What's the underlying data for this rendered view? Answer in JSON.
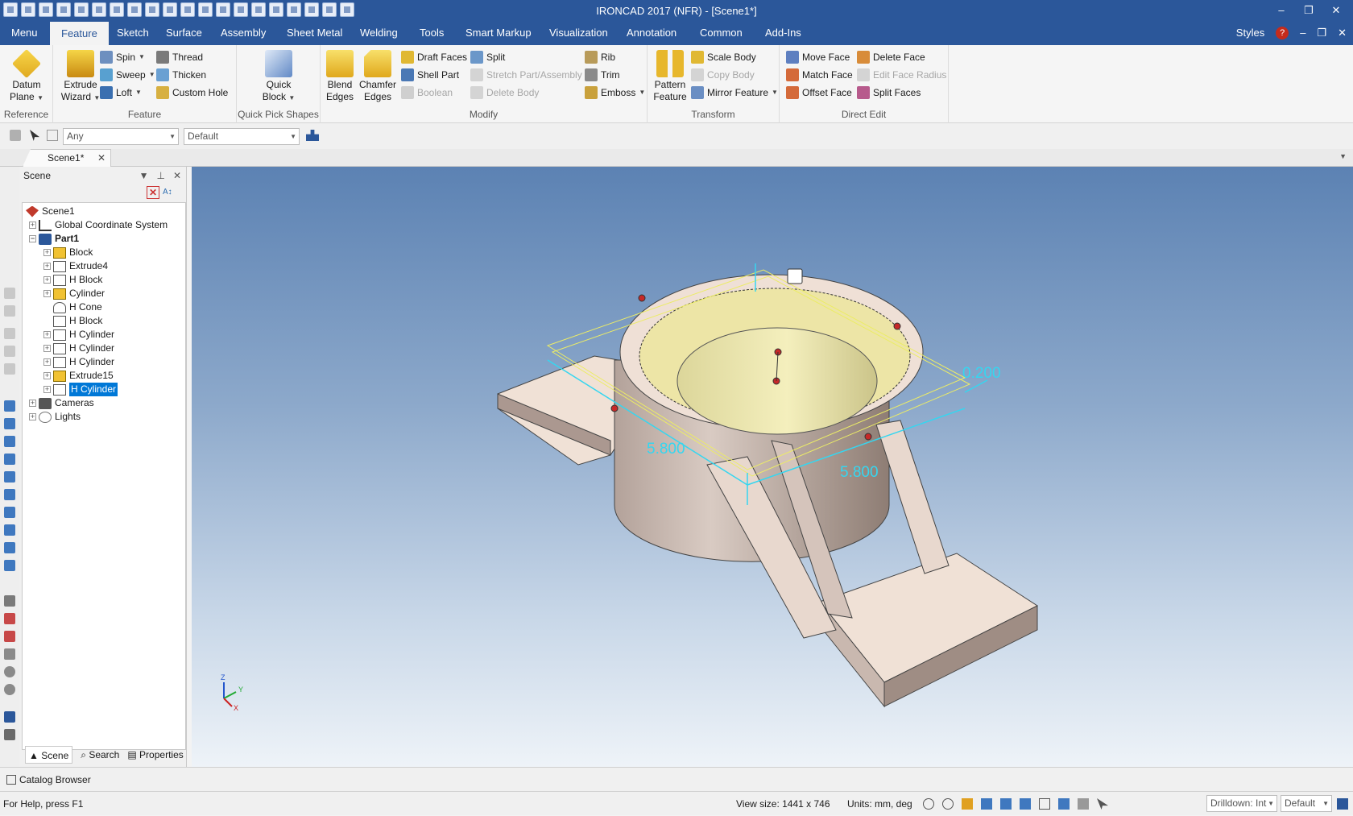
{
  "window": {
    "title": "IRONCAD 2017 (NFR) - [Scene1*]",
    "minimize": "–",
    "restore": "❐",
    "close": "✕"
  },
  "menu": {
    "tabs": [
      "Menu",
      "Feature",
      "Sketch",
      "Surface",
      "Assembly",
      "Sheet Metal",
      "Welding",
      "Tools",
      "Smart Markup",
      "Visualization",
      "Annotation",
      "Common",
      "Add-Ins"
    ],
    "active": "Feature",
    "styles": "Styles",
    "help": "?"
  },
  "ribbon": {
    "reference": {
      "label": "Reference",
      "datum_plane": "Datum Plane"
    },
    "feature": {
      "label": "Feature",
      "extrude_wizard": "Extrude Wizard",
      "spin": "Spin",
      "sweep": "Sweep",
      "loft": "Loft",
      "thread": "Thread",
      "thicken": "Thicken",
      "custom_hole": "Custom Hole"
    },
    "quick_pick": {
      "label": "Quick Pick Shapes",
      "quick_block": "Quick Block"
    },
    "modify": {
      "label": "Modify",
      "blend_edges": "Blend Edges",
      "chamfer_edges": "Chamfer Edges",
      "draft_faces": "Draft Faces",
      "shell_part": "Shell Part",
      "boolean": "Boolean",
      "split": "Split",
      "stretch": "Stretch Part/Assembly",
      "delete_body": "Delete Body",
      "rib": "Rib",
      "trim": "Trim",
      "emboss": "Emboss"
    },
    "transform": {
      "label": "Transform",
      "pattern_feature": "Pattern Feature",
      "scale_body": "Scale Body",
      "copy_body": "Copy Body",
      "mirror_feature": "Mirror Feature"
    },
    "direct_edit": {
      "label": "Direct Edit",
      "move_face": "Move Face",
      "match_face": "Match Face",
      "offset_face": "Offset Face",
      "delete_face": "Delete Face",
      "edit_face_radius": "Edit Face Radius",
      "split_faces": "Split Faces"
    }
  },
  "toolbar": {
    "filter": "Any",
    "style": "Default"
  },
  "doc_tab": "Scene1*",
  "scene_panel": {
    "title": "Scene",
    "tree": [
      {
        "label": "Scene1",
        "level": 0
      },
      {
        "label": "Global Coordinate System",
        "level": 1
      },
      {
        "label": "Part1",
        "level": 1,
        "bold": true
      },
      {
        "label": "Block",
        "level": 2
      },
      {
        "label": "Extrude4",
        "level": 2
      },
      {
        "label": "H Block",
        "level": 2
      },
      {
        "label": "Cylinder",
        "level": 2
      },
      {
        "label": "H Cone",
        "level": 2
      },
      {
        "label": "H Block",
        "level": 2
      },
      {
        "label": "H Cylinder",
        "level": 2
      },
      {
        "label": "H Cylinder",
        "level": 2
      },
      {
        "label": "H Cylinder",
        "level": 2
      },
      {
        "label": "Extrude15",
        "level": 2
      },
      {
        "label": "H Cylinder",
        "level": 2,
        "selected": true
      },
      {
        "label": "Cameras",
        "level": 1
      },
      {
        "label": "Lights",
        "level": 1
      }
    ],
    "tabs": {
      "scene": "Scene",
      "search": "Search",
      "properties": "Properties"
    }
  },
  "viewport": {
    "dims": {
      "d1": "5.800",
      "d2": "5.800",
      "d3": "0.200"
    },
    "triad": {
      "z": "Z",
      "y": "Y",
      "x": "X"
    }
  },
  "catalog_browser": "Catalog Browser",
  "status": {
    "help": "For Help, press F1",
    "view_size": "View size: 1441 x  746",
    "units": "Units: mm, deg",
    "drilldown": "Drilldown: Int",
    "mode": "Default"
  }
}
